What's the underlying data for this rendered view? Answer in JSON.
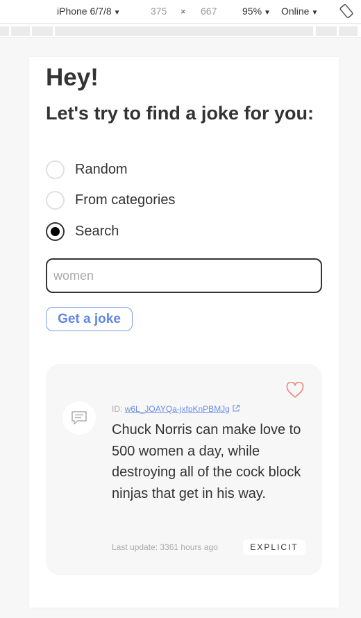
{
  "devtools": {
    "device": "iPhone 6/7/8",
    "width": "375",
    "times": "×",
    "height": "667",
    "zoom": "95%",
    "network": "Online",
    "dropdown_arrow": "▼"
  },
  "page": {
    "heading": "Hey!",
    "subtitle": "Let's try to find a joke for you:",
    "options": [
      {
        "label": "Random",
        "checked": false
      },
      {
        "label": "From categories",
        "checked": false
      },
      {
        "label": "Search",
        "checked": true
      }
    ],
    "search": {
      "value": "",
      "placeholder": "women"
    },
    "button_label": "Get a joke"
  },
  "joke": {
    "id_prefix": "ID:",
    "id": "w6L_JOAYQa-jxfpKnPBMJg",
    "text": "Chuck Norris can make love to 500 women a day, while destroying all of the cock block ninjas that get in his way.",
    "last_update": "Last update: 3361 hours ago",
    "badge": "EXPLICIT"
  },
  "colors": {
    "accent": "#5f86e6",
    "heart": "#e98a80",
    "card_bg": "#f7f7f7"
  },
  "icons": [
    "rotate-icon",
    "heart-icon",
    "message-icon",
    "external-link-icon"
  ]
}
